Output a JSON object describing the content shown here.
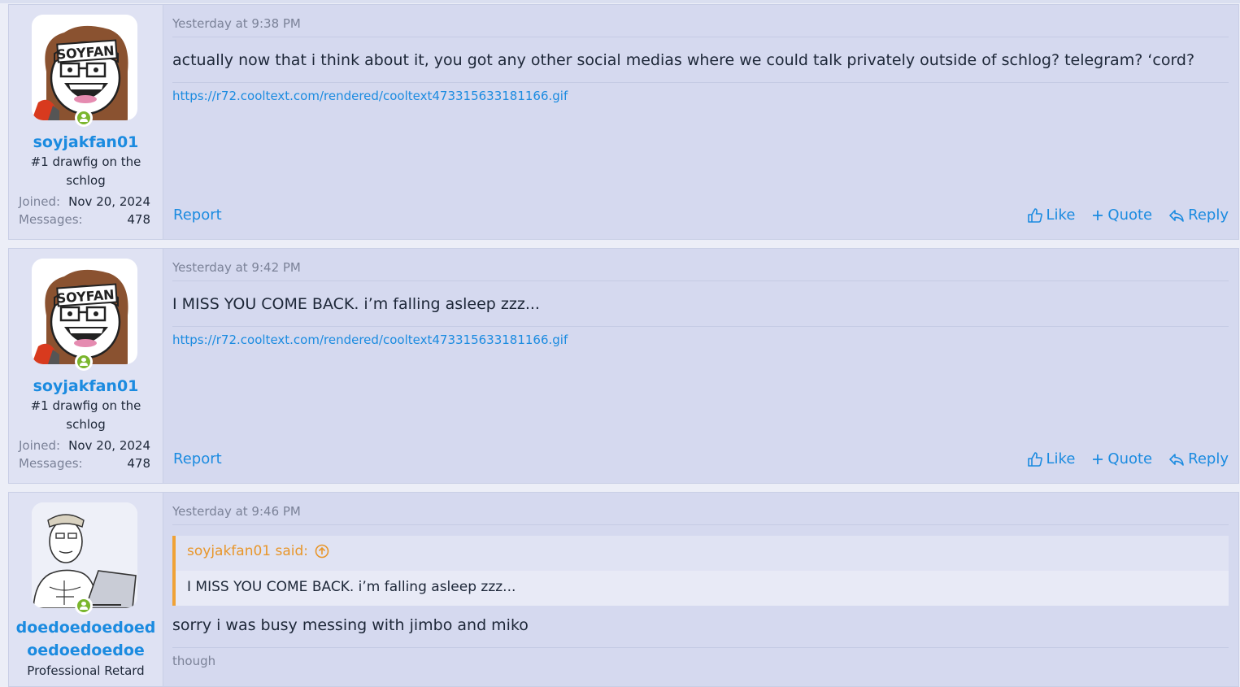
{
  "posts": [
    {
      "username": "soyjakfan01",
      "user_title": "#1 drawfig on the schlog",
      "joined_label": "Joined:",
      "joined_value": "Nov 20, 2024",
      "messages_label": "Messages:",
      "messages_value": "478",
      "avatar_text": "SOYFAN",
      "timestamp": "Yesterday at 9:38 PM",
      "body": "actually now that i think about it, you got any other social medias where we could talk privately outside of schlog? telegram? ‘cord?",
      "signature_link": "https://r72.cooltext.com/rendered/cooltext473315633181166.gif",
      "report": "Report",
      "like": "Like",
      "quote": "Quote",
      "reply": "Reply"
    },
    {
      "username": "soyjakfan01",
      "user_title": "#1 drawfig on the schlog",
      "joined_label": "Joined:",
      "joined_value": "Nov 20, 2024",
      "messages_label": "Messages:",
      "messages_value": "478",
      "avatar_text": "SOYFAN",
      "timestamp": "Yesterday at 9:42 PM",
      "body": "I MISS YOU COME BACK. i’m falling asleep zzz...",
      "signature_link": "https://r72.cooltext.com/rendered/cooltext473315633181166.gif",
      "report": "Report",
      "like": "Like",
      "quote": "Quote",
      "reply": "Reply"
    },
    {
      "username_line1": "doedoedoedoed",
      "username_line2": "oedoedoedoe",
      "user_title": "Professional Retard",
      "timestamp": "Yesterday at 9:46 PM",
      "quote_author": "soyjakfan01 said:",
      "quote_text": "I MISS YOU COME BACK. i’m falling asleep zzz...",
      "body": "sorry i was busy messing with jimbo and miko",
      "signature_text": "though"
    }
  ],
  "colors": {
    "accent": "#1b8be0",
    "quote_border": "#f0a236",
    "online": "#7ab62d",
    "post_bg": "#d5d9ef",
    "user_bg": "#dfe2f3"
  },
  "icons": [
    "online-status-icon",
    "like-icon",
    "plus-icon",
    "reply-icon",
    "quote-jump-icon"
  ]
}
